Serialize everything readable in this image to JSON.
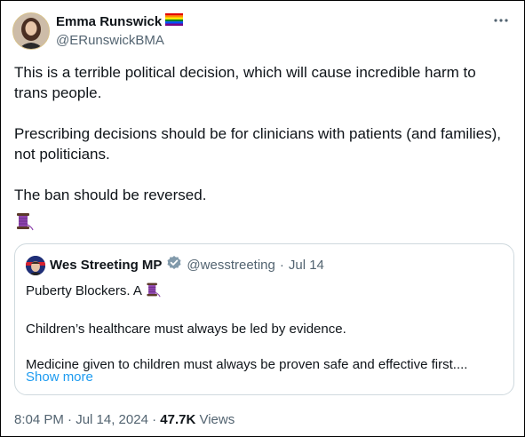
{
  "tweet": {
    "author_name": "Emma Runswick",
    "author_handle": "@ERunswickBMA",
    "paragraphs": [
      "This is a terrible political decision, which will cause incredible harm to trans people.",
      "Prescribing decisions should be for clinicians with patients (and families), not politicians.",
      "The ban should be reversed."
    ],
    "emoji_icon": "spool-of-thread-icon",
    "timestamp": "8:04 PM · Jul 14, 2024",
    "views_count": "47.7K",
    "views_label": "Views",
    "separator": "·"
  },
  "quote": {
    "author_name": "Wes Streeting MP",
    "author_handle": "@wesstreeting",
    "separator": "·",
    "date": "Jul 14",
    "line1": "Puberty Blockers. A",
    "line2": "Children’s healthcare must always be led by evidence.",
    "line3": "Medicine given to children must always be proven safe and effective first....",
    "show_more": "Show more"
  },
  "colors": {
    "link": "#1d9bf0",
    "secondary_text": "#536471",
    "border": "#cfd9de",
    "verified_badge": "#829aab"
  }
}
